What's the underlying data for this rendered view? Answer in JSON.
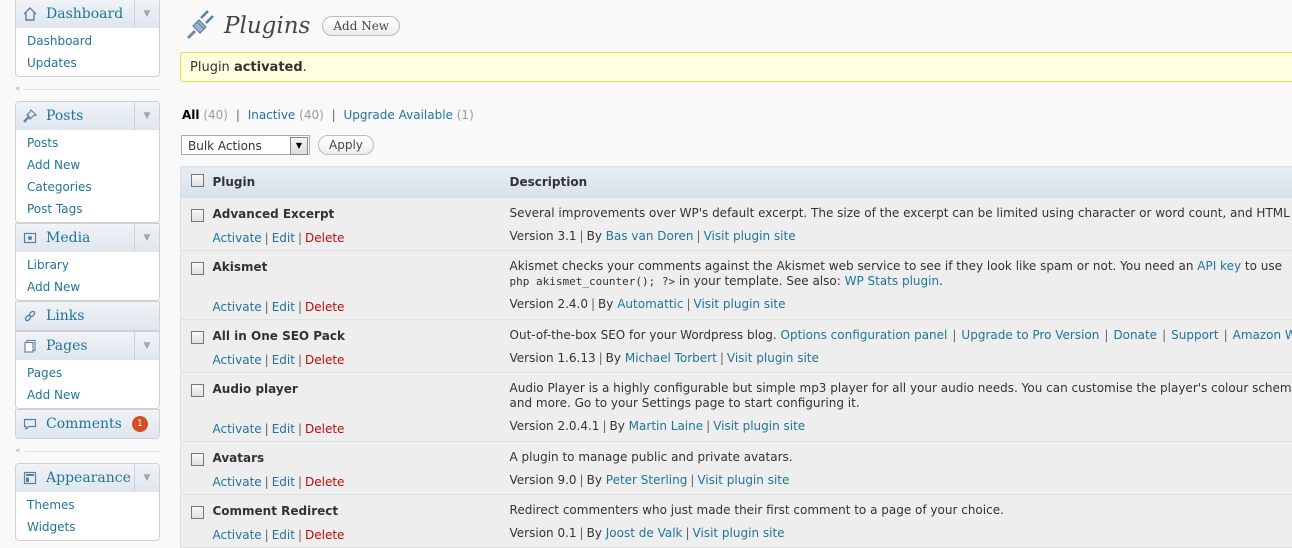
{
  "sidebar": {
    "dashboard": {
      "label": "Dashboard",
      "items": [
        "Dashboard",
        "Updates"
      ]
    },
    "posts": {
      "label": "Posts",
      "items": [
        "Posts",
        "Add New",
        "Categories",
        "Post Tags"
      ]
    },
    "media": {
      "label": "Media",
      "items": [
        "Library",
        "Add New"
      ]
    },
    "links": {
      "label": "Links"
    },
    "pages": {
      "label": "Pages",
      "items": [
        "Pages",
        "Add New"
      ]
    },
    "comments": {
      "label": "Comments",
      "badge": "1"
    },
    "appearance": {
      "label": "Appearance",
      "items": [
        "Themes",
        "Widgets"
      ]
    }
  },
  "header": {
    "title": "Plugins",
    "add_new": "Add New"
  },
  "notice": {
    "prefix": "Plugin ",
    "strong": "activated",
    "suffix": "."
  },
  "filters": {
    "all": "All",
    "all_count": "(40)",
    "inactive": "Inactive",
    "inactive_count": "(40)",
    "upgrade": "Upgrade Available",
    "upgrade_count": "(1)",
    "separator": "|"
  },
  "bulk": {
    "selected": "Bulk Actions",
    "apply": "Apply"
  },
  "table": {
    "col_plugin": "Plugin",
    "col_description": "Description",
    "action_activate": "Activate",
    "action_edit": "Edit",
    "action_delete": "Delete",
    "sep": "|",
    "by": "By",
    "visit": "Visit plugin site",
    "rows": [
      {
        "name": "Advanced Excerpt",
        "desc": "Several improvements over WP's default excerpt. The size of the excerpt can be limited using character or word count, and HTML",
        "version": "Version 3.1",
        "author": "Bas van Doren"
      },
      {
        "name": "Akismet",
        "desc_pre": "Akismet checks your comments against the Akismet web service to see if they look like spam or not. You need an ",
        "desc_link1": "API key",
        "desc_mid": " to use",
        "desc_code": "php akismet_counter(); ?>",
        "desc_after_code": " in your template. See also: ",
        "desc_link2": "WP Stats plugin",
        "desc_end": ".",
        "version": "Version 2.4.0",
        "author": "Automattic"
      },
      {
        "name": "All in One SEO Pack",
        "desc_pre": "Out-of-the-box SEO for your Wordpress blog. ",
        "links": [
          "Options configuration panel",
          "Upgrade to Pro Version",
          "Donate",
          "Support",
          "Amazon W"
        ],
        "version": "Version 1.6.13",
        "author": "Michael Torbert"
      },
      {
        "name": "Audio player",
        "desc_line1": "Audio Player is a highly configurable but simple mp3 player for all your audio needs. You can customise the player's colour scheme",
        "desc_line2": "and more. Go to your Settings page to start configuring it.",
        "version": "Version 2.0.4.1",
        "author": "Martin Laine"
      },
      {
        "name": "Avatars",
        "desc": "A plugin to manage public and private avatars.",
        "version": "Version 9.0",
        "author": "Peter Sterling"
      },
      {
        "name": "Comment Redirect",
        "desc": "Redirect commenters who just made their first comment to a page of your choice.",
        "version": "Version 0.1",
        "author": "Joost de Valk"
      }
    ]
  }
}
